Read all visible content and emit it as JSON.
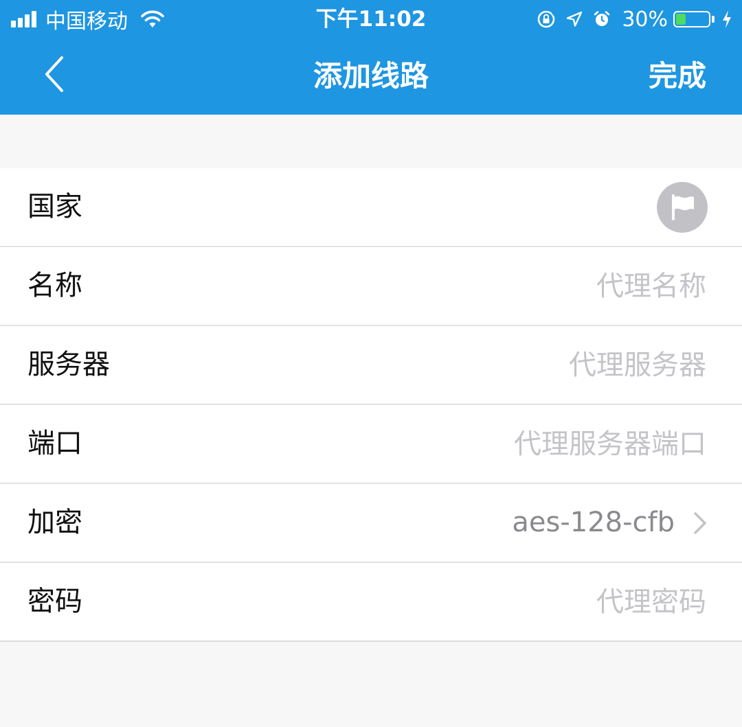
{
  "status_bar": {
    "carrier": "中国移动",
    "time": "下午11:02",
    "battery_percent": "30%",
    "battery_level": 0.3,
    "battery_color": "#4cd964"
  },
  "nav": {
    "title": "添加线路",
    "done_label": "完成",
    "background_color": "#1e96e1"
  },
  "form": {
    "rows": [
      {
        "label": "国家",
        "type": "icon",
        "icon": "flag-icon"
      },
      {
        "label": "名称",
        "type": "input",
        "placeholder": "代理名称",
        "value": ""
      },
      {
        "label": "服务器",
        "type": "input",
        "placeholder": "代理服务器",
        "value": ""
      },
      {
        "label": "端口",
        "type": "input",
        "placeholder": "代理服务器端口",
        "value": ""
      },
      {
        "label": "加密",
        "type": "select",
        "value": "aes-128-cfb",
        "icon": "chevron-right-icon"
      },
      {
        "label": "密码",
        "type": "input",
        "placeholder": "代理密码",
        "value": ""
      }
    ]
  }
}
